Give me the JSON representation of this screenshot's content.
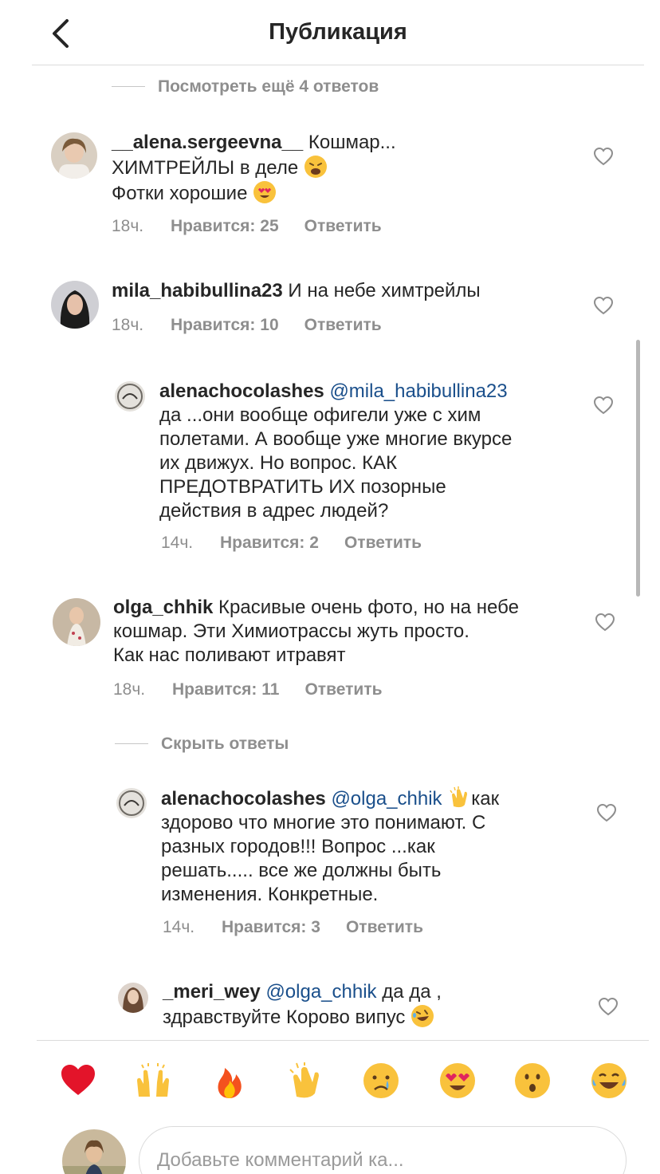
{
  "header": {
    "title": "Публикация",
    "back_icon": "chevron-left-icon"
  },
  "view_more": {
    "label": "Посмотреть ещё 4 ответов"
  },
  "hide_replies": {
    "label": "Скрыть ответы"
  },
  "comments": [
    {
      "user": "__alena.sergeevna__",
      "line1": "Кошмар...",
      "line2": "ХИМТРЕЙЛЫ в деле",
      "line3": "Фотки хорошие",
      "time": "18ч.",
      "likes": "Нравится: 25",
      "reply": "Ответить"
    },
    {
      "user": "mila_habibullina23",
      "text": "И на небе химтрейлы",
      "time": "18ч.",
      "likes": "Нравится: 10",
      "reply": "Ответить"
    },
    {
      "user": "alenachocolashes",
      "mention": "@mila_habibullina23",
      "lines": [
        "да ...они вообще офигели уже с хим",
        "полетами. А вообще уже многие вкурсе",
        "их движух. Но вопрос. КАК",
        "ПРЕДОТВРАТИТЬ ИХ позорные",
        "действия в адрес  людей?"
      ],
      "time": "14ч.",
      "likes": "Нравится: 2",
      "reply": "Ответить"
    },
    {
      "user": "olga_chhik",
      "line1": "Красивые очень фото, но на небе",
      "line2": "кошмар. Эти  Химиотрассы жуть просто.",
      "line3": "Как нас поливают итравят",
      "time": "18ч.",
      "likes": "Нравится: 11",
      "reply": "Ответить"
    },
    {
      "user": "alenachocolashes",
      "mention": "@olga_chhik",
      "after_emoji": "как",
      "lines": [
        "здорово что многие это понимают. С",
        "разных городов!!! Вопрос ...как",
        "решать..... все же должны быть",
        "изменения. Конкретные."
      ],
      "time": "14ч.",
      "likes": "Нравится: 3",
      "reply": "Ответить"
    },
    {
      "user": "_meri_wey",
      "mention": "@olga_chhik",
      "after_mention": "да да ,",
      "line2": "здравствуйте Корово випус"
    }
  ],
  "emoji_bar": [
    "red-heart",
    "raising-hands",
    "fire",
    "clapping-hands",
    "crying-face",
    "heart-eyes",
    "astonished-face",
    "tears-of-joy"
  ],
  "compose": {
    "placeholder": "Добавьте комментарий ка..."
  },
  "colors": {
    "text": "#262626",
    "secondary": "#8e8e8e",
    "mention": "#1a4f8b",
    "divider": "#dbdbdb"
  }
}
